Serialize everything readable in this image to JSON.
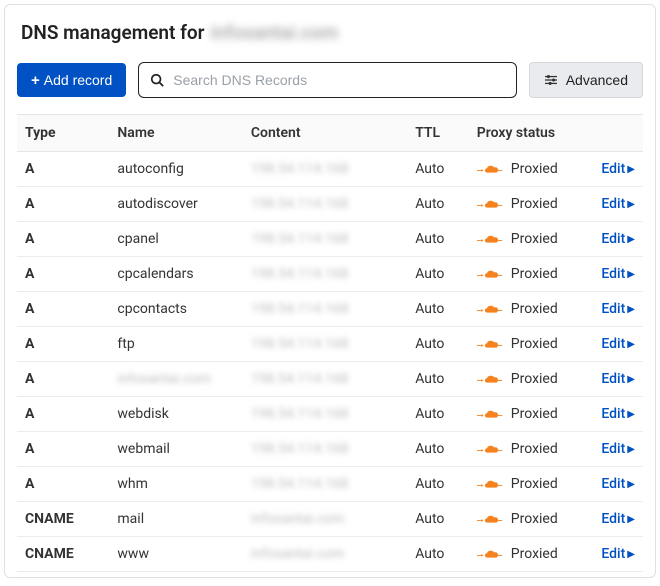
{
  "header": {
    "title_prefix": "DNS management for",
    "domain_masked": "infosantai.com"
  },
  "controls": {
    "add_label": "Add record",
    "search_placeholder": "Search DNS Records",
    "advanced_label": "Advanced"
  },
  "table": {
    "headers": {
      "type": "Type",
      "name": "Name",
      "content": "Content",
      "ttl": "TTL",
      "proxy": "Proxy status"
    },
    "edit_label": "Edit",
    "rows": [
      {
        "type": "A",
        "name": "autoconfig",
        "name_masked": false,
        "content_masked": "198.54.114.168",
        "ttl": "Auto",
        "proxy": "Proxied"
      },
      {
        "type": "A",
        "name": "autodiscover",
        "name_masked": false,
        "content_masked": "198.54.114.168",
        "ttl": "Auto",
        "proxy": "Proxied"
      },
      {
        "type": "A",
        "name": "cpanel",
        "name_masked": false,
        "content_masked": "198.54.114.168",
        "ttl": "Auto",
        "proxy": "Proxied"
      },
      {
        "type": "A",
        "name": "cpcalendars",
        "name_masked": false,
        "content_masked": "198.54.114.168",
        "ttl": "Auto",
        "proxy": "Proxied"
      },
      {
        "type": "A",
        "name": "cpcontacts",
        "name_masked": false,
        "content_masked": "198.54.114.168",
        "ttl": "Auto",
        "proxy": "Proxied"
      },
      {
        "type": "A",
        "name": "ftp",
        "name_masked": false,
        "content_masked": "198.54.114.168",
        "ttl": "Auto",
        "proxy": "Proxied"
      },
      {
        "type": "A",
        "name": "infosantai.com",
        "name_masked": true,
        "content_masked": "198.54.114.168",
        "ttl": "Auto",
        "proxy": "Proxied"
      },
      {
        "type": "A",
        "name": "webdisk",
        "name_masked": false,
        "content_masked": "198.54.114.168",
        "ttl": "Auto",
        "proxy": "Proxied"
      },
      {
        "type": "A",
        "name": "webmail",
        "name_masked": false,
        "content_masked": "198.54.114.168",
        "ttl": "Auto",
        "proxy": "Proxied"
      },
      {
        "type": "A",
        "name": "whm",
        "name_masked": false,
        "content_masked": "198.54.114.168",
        "ttl": "Auto",
        "proxy": "Proxied"
      },
      {
        "type": "CNAME",
        "name": "mail",
        "name_masked": false,
        "content_masked": "infosantai.com",
        "ttl": "Auto",
        "proxy": "Proxied"
      },
      {
        "type": "CNAME",
        "name": "www",
        "name_masked": false,
        "content_masked": "infosantai.com",
        "ttl": "Auto",
        "proxy": "Proxied"
      }
    ]
  }
}
